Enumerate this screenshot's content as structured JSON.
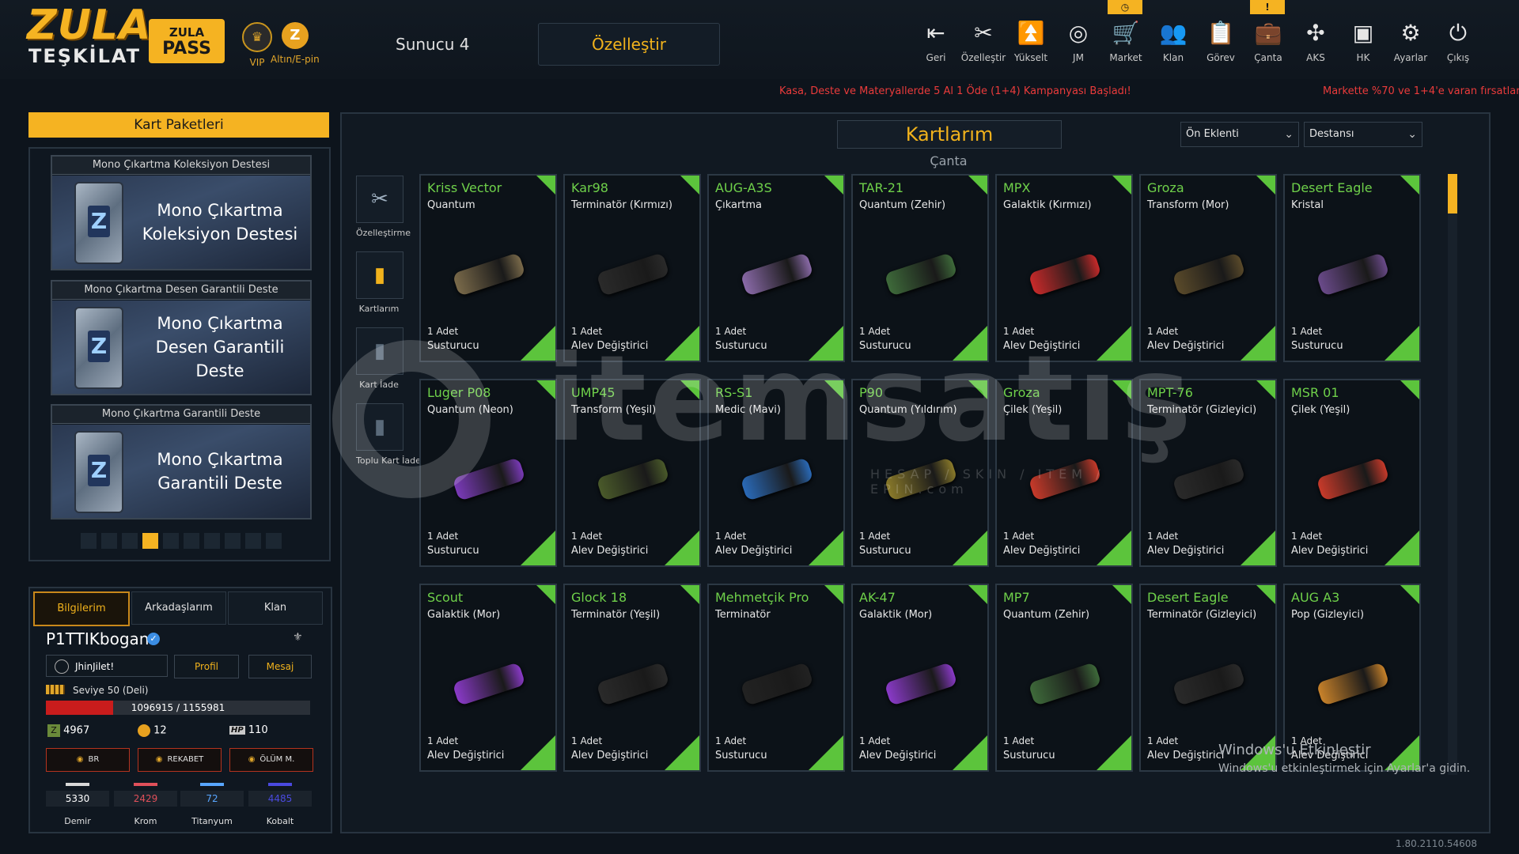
{
  "logo": {
    "line1": "ZULA",
    "line2": "TEŞKİLAT"
  },
  "pass": {
    "line1": "ZULA",
    "line2": "PASS"
  },
  "vip_label": "VIP",
  "gold_label": "Altın/E-pin",
  "server": "Sunucu 4",
  "customize_button": "Özelleştir",
  "nav": [
    {
      "label": "Geri",
      "icon": "back-icon"
    },
    {
      "label": "Özelleştir",
      "icon": "tools-icon"
    },
    {
      "label": "Yükselt",
      "icon": "upgrade-icon"
    },
    {
      "label": "JM",
      "icon": "coins-icon"
    },
    {
      "label": "Market",
      "icon": "cart-icon"
    },
    {
      "label": "Klan",
      "icon": "clan-icon"
    },
    {
      "label": "Görev",
      "icon": "clipboard-icon"
    },
    {
      "label": "Çanta",
      "icon": "bag-icon"
    },
    {
      "label": "AKS",
      "icon": "crosshair-icon"
    },
    {
      "label": "HK",
      "icon": "window-icon"
    },
    {
      "label": "Ayarlar",
      "icon": "gear-icon"
    },
    {
      "label": "Çıkış",
      "icon": "power-icon"
    }
  ],
  "ticker": [
    "Kasa, Deste ve Materyallerde 5 Al 1 Öde (1+4) Kampanyası Başladı!",
    "Markette %70 ve 1+4'e varan fırsatlar b"
  ],
  "left": {
    "title": "Kart Paketleri",
    "decks": [
      {
        "caption": "Mono Çıkartma Koleksiyon Destesi",
        "name": "Mono Çıkartma Koleksiyon Destesi"
      },
      {
        "caption": "Mono Çıkartma Desen Garantili Deste",
        "name": "Mono Çıkartma Desen Garantili Deste"
      },
      {
        "caption": "Mono Çıkartma Garantili Deste",
        "name": "Mono Çıkartma Garantili Deste"
      }
    ],
    "pager": {
      "count": 10,
      "active": 3
    }
  },
  "profile": {
    "tabs": [
      "Bilgilerim",
      "Arkadaşlarım",
      "Klan"
    ],
    "username": "P1TTIKbogan",
    "status": "JhinJilet!",
    "profile_btn": "Profil",
    "message_btn": "Mesaj",
    "level": "Seviye 50 (Deli)",
    "xp_text": "1096915 / 1155981",
    "xp_fraction": 0.253,
    "currency": {
      "z": "4967",
      "gold": "12",
      "hp": "110",
      "hp_label": "HP"
    },
    "modes": [
      "BR",
      "REKABET",
      "ÖLÜM M."
    ],
    "stats": [
      {
        "value": "5330",
        "name": "Demir",
        "color": "#d8d8d8"
      },
      {
        "value": "2429",
        "name": "Krom",
        "color": "#e0505a"
      },
      {
        "value": "72",
        "name": "Titanyum",
        "color": "#58a6ff"
      },
      {
        "value": "4485",
        "name": "Kobalt",
        "color": "#4a4ae0"
      }
    ]
  },
  "main": {
    "title": "Kartlarım",
    "subtitle": "Çanta",
    "sort": "Ön Eklenti",
    "filter": "Destansı",
    "side": [
      "Özelleştirme",
      "Kartlarım",
      "Kart İade",
      "Toplu Kart İade"
    ],
    "cards": [
      {
        "name": "Kriss Vector",
        "skin": "Quantum",
        "qty": "1 Adet",
        "type": "Susturucu",
        "color": "#7a6a4a"
      },
      {
        "name": "Kar98",
        "skin": "Terminatör (Kırmızı)",
        "qty": "1 Adet",
        "type": "Alev Değiştirici",
        "color": "#2a2a2a"
      },
      {
        "name": "AUG-A3S",
        "skin": "Çıkartma",
        "qty": "1 Adet",
        "type": "Susturucu",
        "color": "#8a6aa8"
      },
      {
        "name": "TAR-21",
        "skin": "Quantum (Zehir)",
        "qty": "1 Adet",
        "type": "Susturucu",
        "color": "#3e6a3a"
      },
      {
        "name": "MPX",
        "skin": "Galaktik (Kırmızı)",
        "qty": "1 Adet",
        "type": "Alev Değiştirici",
        "color": "#c82a2a"
      },
      {
        "name": "Groza",
        "skin": "Transform (Mor)",
        "qty": "1 Adet",
        "type": "Alev Değiştirici",
        "color": "#5a4a2a"
      },
      {
        "name": "Desert Eagle",
        "skin": "Kristal",
        "qty": "1 Adet",
        "type": "Susturucu",
        "color": "#6a4a8a"
      },
      {
        "name": "Luger P08",
        "skin": "Quantum (Neon)",
        "qty": "1 Adet",
        "type": "Susturucu",
        "color": "#7a3ab8"
      },
      {
        "name": "UMP45",
        "skin": "Transform (Yeşil)",
        "qty": "1 Adet",
        "type": "Alev Değiştirici",
        "color": "#4a5a2a"
      },
      {
        "name": "RS-S1",
        "skin": "Medic (Mavi)",
        "qty": "1 Adet",
        "type": "Alev Değiştirici",
        "color": "#2a6ab8"
      },
      {
        "name": "P90",
        "skin": "Quantum (Yıldırım)",
        "qty": "1 Adet",
        "type": "Susturucu",
        "color": "#8a7a2a"
      },
      {
        "name": "Groza",
        "skin": "Çilek (Yeşil)",
        "qty": "1 Adet",
        "type": "Alev Değiştirici",
        "color": "#c83a2a"
      },
      {
        "name": "MPT-76",
        "skin": "Terminatör (Gizleyici)",
        "qty": "1 Adet",
        "type": "Alev Değiştirici",
        "color": "#2a2a2a"
      },
      {
        "name": "MSR 01",
        "skin": "Çilek (Yeşil)",
        "qty": "1 Adet",
        "type": "Alev Değiştirici",
        "color": "#c83a2a"
      },
      {
        "name": "Scout",
        "skin": "Galaktik (Mor)",
        "qty": "1 Adet",
        "type": "Alev Değiştirici",
        "color": "#8a3ac8"
      },
      {
        "name": "Glock 18",
        "skin": "Terminatör (Yeşil)",
        "qty": "1 Adet",
        "type": "Alev Değiştirici",
        "color": "#2a2a2a"
      },
      {
        "name": "Mehmetçik Pro",
        "skin": "Terminatör",
        "qty": "1 Adet",
        "type": "Susturucu",
        "color": "#222222"
      },
      {
        "name": "AK-47",
        "skin": "Galaktik (Mor)",
        "qty": "1 Adet",
        "type": "Alev Değiştirici",
        "color": "#8a3ac8"
      },
      {
        "name": "MP7",
        "skin": "Quantum (Zehir)",
        "qty": "1 Adet",
        "type": "Susturucu",
        "color": "#3e6a3a"
      },
      {
        "name": "Desert Eagle",
        "skin": "Terminatör (Gizleyici)",
        "qty": "1 Adet",
        "type": "Alev Değiştirici",
        "color": "#2a2a2a"
      },
      {
        "name": "AUG A3",
        "skin": "Pop (Gizleyici)",
        "qty": "1 Adet",
        "type": "Alev Değiştirici",
        "color": "#c8822a"
      }
    ]
  },
  "watermark": {
    "brand": "itemsatış",
    "tagline": "HESAP / SKIN / ITEM / EPIN",
    "suffix": ".com"
  },
  "windows": {
    "line1": "Windows'u Etkinleştir",
    "line2": "Windows'u etkinleştirmek için Ayarlar'a gidin."
  },
  "version": "1.80.2110.54608"
}
